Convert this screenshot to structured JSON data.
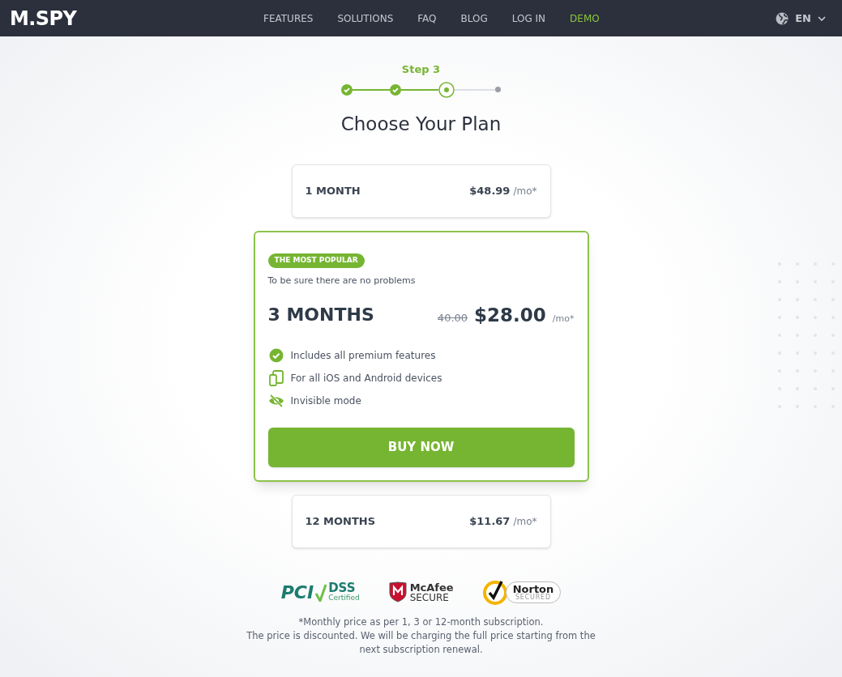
{
  "nav": {
    "logo": "M.SPY",
    "links": [
      {
        "label": "FEATURES",
        "selected": false
      },
      {
        "label": "SOLUTIONS",
        "selected": false
      },
      {
        "label": "FAQ",
        "selected": false
      },
      {
        "label": "BLOG",
        "selected": false
      },
      {
        "label": "LOG IN",
        "selected": false
      },
      {
        "label": "DEMO",
        "selected": true
      }
    ],
    "language": "EN"
  },
  "stepper": {
    "label": "Step 3",
    "steps": [
      {
        "kind": "done"
      },
      {
        "kind": "done"
      },
      {
        "kind": "current"
      },
      {
        "kind": "todo"
      }
    ]
  },
  "title": "Choose Your Plan",
  "plans": [
    {
      "kind": "compact",
      "name": "1 MONTH",
      "price": "$48.99",
      "unit": "/mo*"
    },
    {
      "kind": "featured",
      "badge": "THE MOST POPULAR",
      "subtitle": "To be sure there are no problems",
      "name": "3 MONTHS",
      "old_price": "40.00",
      "price": "$28.00",
      "unit": "/mo*",
      "features": [
        {
          "kind": "check",
          "text": "Includes all premium features"
        },
        {
          "kind": "devices",
          "text": "For all iOS and Android devices"
        },
        {
          "kind": "invisible",
          "text": "Invisible mode"
        }
      ],
      "button": "BUY NOW"
    },
    {
      "kind": "compact",
      "name": "12 MONTHS",
      "price": "$11.67",
      "unit": "/mo*"
    }
  ],
  "badges": [
    {
      "kind": "pci",
      "main": "PCI",
      "side": "DSS",
      "sub": "Certified"
    },
    {
      "kind": "mcafee",
      "main": "McAfee",
      "sub": "SECURE"
    },
    {
      "kind": "norton",
      "main": "Norton",
      "sub": "SECURED"
    }
  ],
  "footnote": [
    "*Monthly price as per 1, 3 or 12-month subscription.",
    "The price is discounted. We will be charging the full price starting from the next subscription renewal."
  ]
}
